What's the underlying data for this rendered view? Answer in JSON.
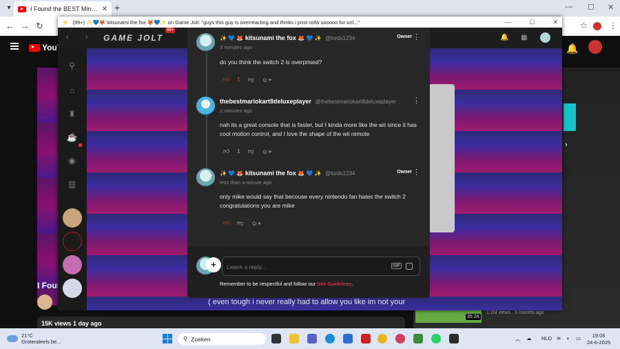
{
  "browser": {
    "tab_title": "I Found the BEST Minecraft Mo",
    "new_tab": "+",
    "back": "←",
    "forward": "→",
    "reload": "↻",
    "minimize": "—",
    "maximize": "☐",
    "close": "✕"
  },
  "youtube": {
    "logo_text": "YouTu",
    "video_title": "I Foun",
    "views_date": "15K views  1 day ago",
    "caption": "( even tough i never really had to allow you like im not your",
    "side_duration": "35:24",
    "side_meta": "1.1M views · 5 months ago"
  },
  "popup": {
    "title": "(99+) ✨💙🦊 kitsunami the fox 🦊💙✨ on Game Jolt: \"guys this guy is overreacting and thinks i post nsfw sooooo for onl...\"",
    "minimize": "—",
    "maximize": "☐",
    "close": "✕"
  },
  "gamejolt": {
    "logo": "GAME JOLT",
    "badge": "99+",
    "nav_back": "‹",
    "nav_forward": "›"
  },
  "comments": [
    {
      "emoji_left": "✨ 💙 🦊",
      "author": "kitsunami the fox",
      "emoji_right": "🦊 💙 ✨",
      "handle": "@lordx1234",
      "time": "3 minutes ago",
      "badge": "Owner",
      "body": "do you think the switch 2 is overprised?",
      "likes": "1"
    },
    {
      "author": "thebestmariokart8deluxeplayer",
      "handle": "@thebestmariokart8deluxeplayer",
      "time": "2 minutes ago",
      "body": "nah its a great console that is faster, but I kinda more like the wii since it has cool motion control, and I love the shape of the wii remote",
      "likes": "1"
    },
    {
      "emoji_left": "✨ 💙 🦊",
      "author": "kitsunami the fox",
      "emoji_right": "🦊 💙 ✨",
      "handle": "@lordx1234",
      "time": "less than a minute ago",
      "badge": "Owner",
      "body": "only mike would say that becouse every nintendo fan hates the switch 2 congratulations you are mike"
    }
  ],
  "reply": {
    "placeholder": "Leave a reply...",
    "gif": "GIF",
    "add": "+",
    "guidelines_prefix": "Remember to be respectful and follow our ",
    "guidelines_link": "Site Guidelines",
    "guidelines_suffix": "."
  },
  "taskbar": {
    "temp": "21°C",
    "weather": "Grotendeels be...",
    "search": "Zoeken",
    "lang": "NLD",
    "time": "19:06",
    "date": "24-6-2025"
  },
  "icons": {
    "like": "thumbs-up-icon",
    "dislike": "thumbs-down-icon",
    "react": "add-reaction-icon",
    "more": "more-vertical-icon"
  },
  "colors": {
    "accent_red": "#e8483c",
    "link_pink": "#ff3c5a",
    "panel_bg": "#272727"
  }
}
